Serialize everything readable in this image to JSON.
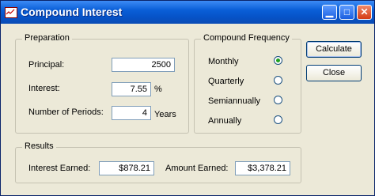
{
  "window": {
    "title": "Compound Interest",
    "icon": "chart-app-icon",
    "controls": {
      "minimize": "minimize-icon",
      "maximize": "maximize-icon",
      "close": "close-icon"
    }
  },
  "preparation": {
    "legend": "Preparation",
    "principal_label": "Principal:",
    "principal_value": "2500",
    "interest_label": "Interest:",
    "interest_value": "7.55",
    "interest_unit": "%",
    "periods_label": "Number of Periods:",
    "periods_value": "4",
    "periods_unit": "Years"
  },
  "frequency": {
    "legend": "Compound Frequency",
    "options": [
      {
        "label": "Monthly",
        "checked": true
      },
      {
        "label": "Quarterly",
        "checked": false
      },
      {
        "label": "Semiannually",
        "checked": false
      },
      {
        "label": "Annually",
        "checked": false
      }
    ]
  },
  "buttons": {
    "calculate": "Calculate",
    "close": "Close"
  },
  "results": {
    "legend": "Results",
    "interest_earned_label": "Interest Earned:",
    "interest_earned_value": "$878.21",
    "amount_earned_label": "Amount Earned:",
    "amount_earned_value": "$3,378.21"
  }
}
